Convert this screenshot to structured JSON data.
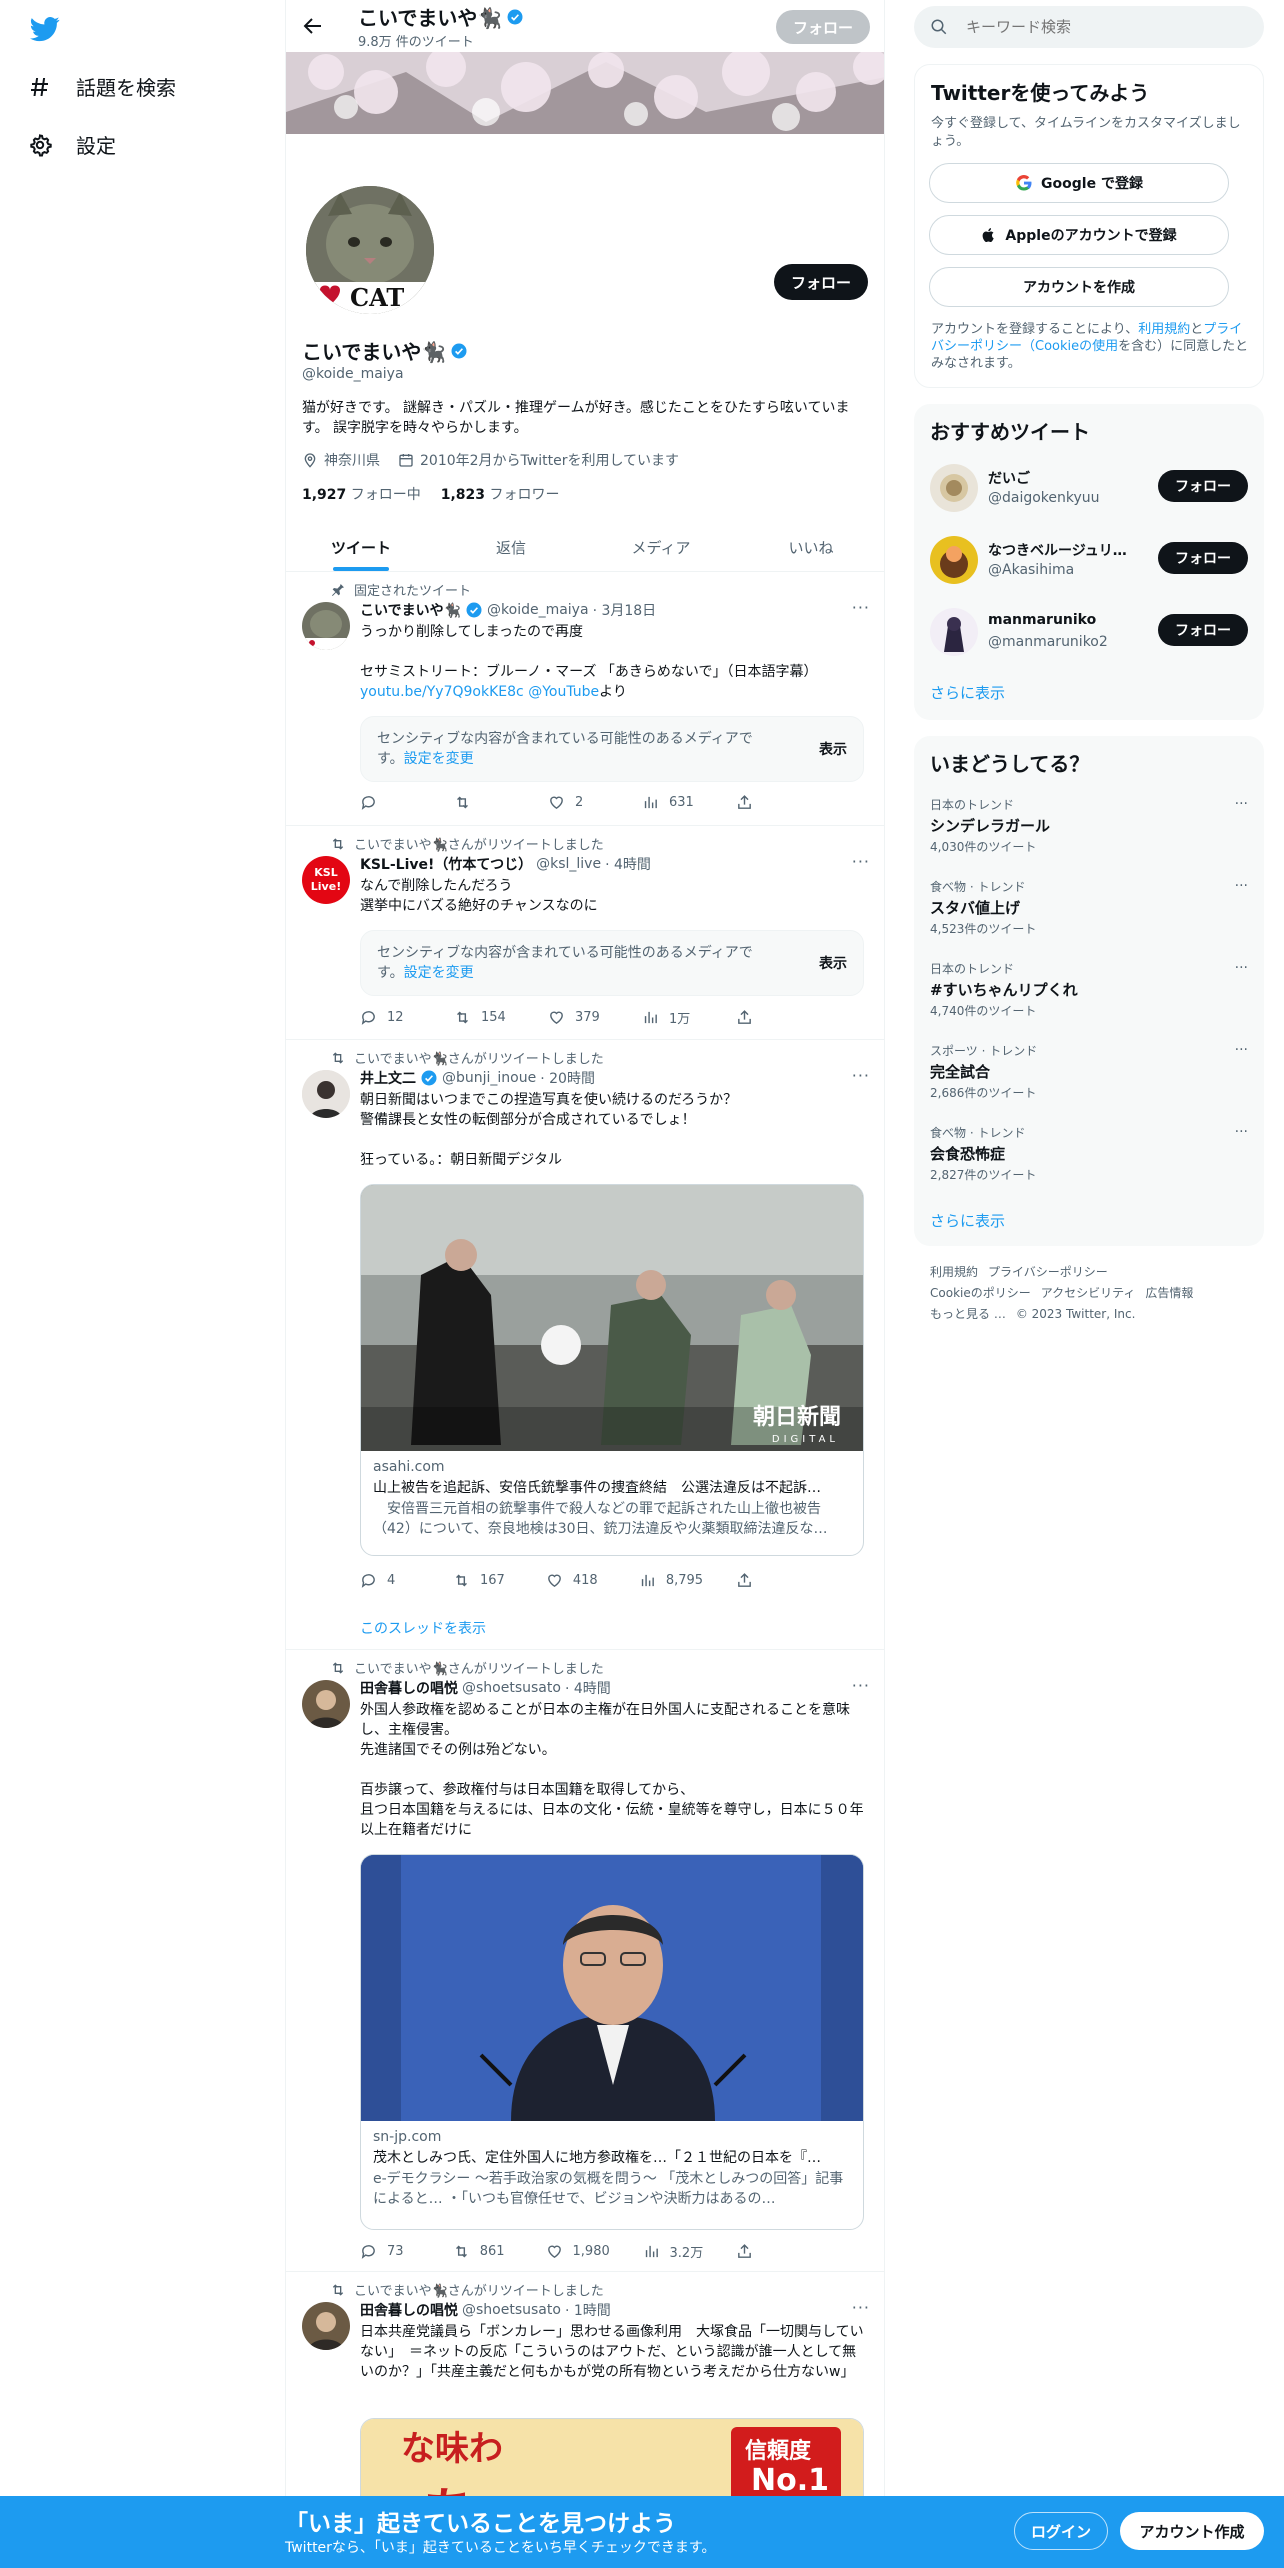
{
  "nav": {
    "explore": "話題を検索",
    "settings": "設定"
  },
  "header": {
    "name": "こいでまいや🐈‍⬛",
    "tweet_count": "9.8万 件のツイート",
    "follow": "フォロー"
  },
  "profile": {
    "name": "こいでまいや🐈‍⬛",
    "handle": "@koide_maiya",
    "bio": "猫が好きです。 謎解き・パズル・推理ゲームが好き。感じたことをひたすら呟いています。 誤字脱字を時々やらかします。",
    "location": "神奈川県",
    "joined": "2010年2月からTwitterを利用しています",
    "following_count": "1,927",
    "following_label": "フォロー中",
    "followers_count": "1,823",
    "followers_label": "フォロワー",
    "follow_button": "フォロー",
    "avatar_text": "CAT"
  },
  "tabs": [
    "ツイート",
    "返信",
    "メディア",
    "いいね"
  ],
  "tweets": [
    {
      "context": "固定されたツイート",
      "name": "こいでまいや🐈‍⬛",
      "handle": "@koide_maiya",
      "time": "· 3月18日",
      "text": "うっかり削除してしまったので再度\n\nセサミストリート：ブルーノ・マーズ 「あきらめないで」（日本語字幕）",
      "link1": "youtu.be/Yy7Q9okKE8c",
      "link2": "@YouTube",
      "link_suffix": "より",
      "sensitive": "センシティブな内容が含まれている可能性のあるメディアです。",
      "sensitive_link": "設定を変更",
      "show": "表示",
      "replies": "",
      "retweets": "",
      "likes": "2",
      "views": "631"
    },
    {
      "context": "こいでまいや🐈‍⬛さんがリツイートしました",
      "name": "KSL-Live!（竹本てつじ）",
      "handle": "@ksl_live",
      "time": "· 4時間",
      "text": "なんで削除したんだろう\n選挙中にバズる絶好のチャンスなのに",
      "avatar_text": "KSL Live!",
      "sensitive": "センシティブな内容が含まれている可能性のあるメディアです。",
      "sensitive_link": "設定を変更",
      "show": "表示",
      "replies": "12",
      "retweets": "154",
      "likes": "379",
      "views": "1万"
    },
    {
      "context": "こいでまいや🐈‍⬛さんがリツイートしました",
      "name": "井上文二",
      "handle": "@bunji_inoue",
      "time": "· 20時間",
      "text": "朝日新聞はいつまでこの捏造写真を使い続けるのだろうか？\n警備課長と女性の転倒部分が合成されているでしょ！\n\n狂っている。：朝日新聞デジタル",
      "card_domain": "asahi.com",
      "card_title": "山上被告を追起訴、安倍氏銃撃事件の捜査終結　公選法違反は不起訴…",
      "card_desc": "　安倍晋三元首相の銃撃事件で殺人などの罪で起訴された山上徹也被告（42）について、奈良地検は30日、銃刀法違反や火薬類取締法違反な…",
      "card_logo": "朝日新聞",
      "card_logo_sub": "DIGITAL",
      "replies": "4",
      "retweets": "167",
      "likes": "418",
      "views": "8,795",
      "thread_link": "このスレッドを表示"
    },
    {
      "context": "こいでまいや🐈‍⬛さんがリツイートしました",
      "name": "田舎暮しの唱悦",
      "handle": "@shoetsusato",
      "time": "· 4時間",
      "text": "外国人参政権を認めることが日本の主権が在日外国人に支配されることを意味し、主権侵害。\n先進諸国でその例は殆どない。\n\n百歩譲って、参政権付与は日本国籍を取得してから、\n且つ日本国籍を与えるには、日本の文化・伝統・皇統等を尊守し，日本に５０年以上在籍者だけに",
      "card_domain": "sn-jp.com",
      "card_title": "茂木としみつ氏、定住外国人に地方参政権を…「２１世紀の日本を『…",
      "card_desc": "e-デモクラシー ～若手政治家の気概を問う～ 「茂木としみつの回答」記事によると… ・「いつも官僚任せで、ビジョンや決断力はあるの…",
      "replies": "73",
      "retweets": "861",
      "likes": "1,980",
      "views": "3.2万"
    },
    {
      "context": "こいでまいや🐈‍⬛さんがリツイートしました",
      "name": "田舎暮しの唱悦",
      "handle": "@shoetsusato",
      "time": "· 1時間",
      "text": "日本共産党議員ら「ボンカレー」思わせる画像利用　大塚食品「一切関与していない」　＝ネットの反応「こういうのはアウトだ、という認識が誰一人として無いのか？」「共産主義だと何もかもが党の所有物という考えだから仕方ないw」",
      "img_text1": "な味わ",
      "img_text2": "あ",
      "img_badge1": "信頼度",
      "img_badge2": "No.1"
    }
  ],
  "search": {
    "placeholder": "キーワード検索"
  },
  "signup": {
    "title": "Twitterを使ってみよう",
    "subtitle": "今すぐ登録して、タイムラインをカスタマイズしましょう。",
    "google": "Google で登録",
    "apple": "Appleのアカウントで登録",
    "create": "アカウントを作成",
    "terms_prefix": "アカウントを登録することにより、",
    "terms_link1": "利用規約",
    "terms_and": "と",
    "terms_link2": "プライバシーポリシー（Cookieの使用",
    "terms_suffix": "を含む）に同意したとみなされます。"
  },
  "recommend": {
    "title": "おすすめツイート",
    "users": [
      {
        "name": "だいご",
        "handle": "@daigokenkyuu",
        "button": "フォロー"
      },
      {
        "name": "なつきベルージュリ…",
        "handle": "@Akasihima",
        "button": "フォロー"
      },
      {
        "name": "manmaruniko",
        "handle": "@manmaruniko2",
        "button": "フォロー"
      }
    ],
    "more": "さらに表示"
  },
  "trends": {
    "title": "いまどうしてる？",
    "items": [
      {
        "category": "日本のトレンド",
        "name": "シンデレラガール",
        "count": "4,030件のツイート"
      },
      {
        "category": "食べ物 · トレンド",
        "name": "スタバ値上げ",
        "count": "4,523件のツイート"
      },
      {
        "category": "日本のトレンド",
        "name": "#すいちゃんリプくれ",
        "count": "4,740件のツイート"
      },
      {
        "category": "スポーツ · トレンド",
        "name": "完全試合",
        "count": "2,686件のツイート"
      },
      {
        "category": "食べ物 · トレンド",
        "name": "会食恐怖症",
        "count": "2,827件のツイート"
      }
    ],
    "more": "さらに表示"
  },
  "footer": {
    "terms": "利用規約",
    "privacy": "プライバシーポリシー",
    "cookie": "Cookieのポリシー",
    "accessibility": "アクセシビリティ",
    "ads": "広告情報",
    "more": "もっと見る …",
    "copyright": "© 2023 Twitter, Inc."
  },
  "bottom_bar": {
    "title": "「いま」起きていることを見つけよう",
    "subtitle": "Twitterなら、「いま」起きていることをいち早くチェックできます。",
    "login": "ログイン",
    "signup": "アカウント作成"
  },
  "colors": {
    "accent": "#1d9bf0",
    "text": "#0f1419",
    "muted": "#536471"
  }
}
